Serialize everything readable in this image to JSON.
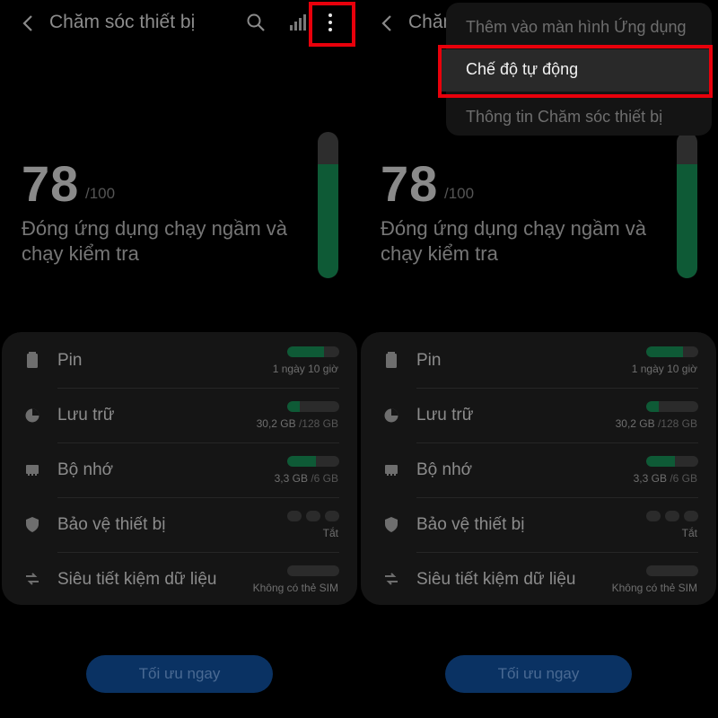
{
  "header": {
    "title": "Chăm sóc thiết bị",
    "title_truncated": "Chăm",
    "icons": [
      "back-arrow-icon",
      "search-icon",
      "signal-icon",
      "more-options-icon"
    ]
  },
  "score": {
    "value": "78",
    "max": "/100",
    "description": "Đóng ứng dụng chạy ngầm và chạy kiểm tra",
    "gauge_level": 0.78
  },
  "items": [
    {
      "label": "Pin",
      "value": "1 ngày 10 giờ",
      "value_sub": "",
      "fill": 0.7,
      "icon": "battery-icon"
    },
    {
      "label": "Lưu trữ",
      "value": "30,2 GB",
      "value_sub": " /128 GB",
      "fill": 0.24,
      "icon": "storage-pie-icon"
    },
    {
      "label": "Bộ nhớ",
      "value": "3,3 GB",
      "value_sub": " /6 GB",
      "fill": 0.55,
      "icon": "memory-chip-icon"
    },
    {
      "label": "Bảo vệ thiết bị",
      "value": "Tắt",
      "value_sub": "",
      "fill": null,
      "icon": "shield-icon"
    },
    {
      "label": "Siêu tiết kiệm dữ liệu",
      "value": "Không có thẻ SIM",
      "value_sub": "",
      "fill": 0,
      "icon": "data-saver-icon"
    }
  ],
  "button": {
    "label": "Tối ưu ngay"
  },
  "menu": {
    "items": [
      "Thêm vào màn hình Ứng dụng",
      "Chế độ tự động",
      "Thông tin Chăm sóc thiết bị"
    ],
    "selected_index": 1
  },
  "colors": {
    "highlight": "#e8000b",
    "progress": "#0e5a36",
    "button": "#0a3263"
  }
}
